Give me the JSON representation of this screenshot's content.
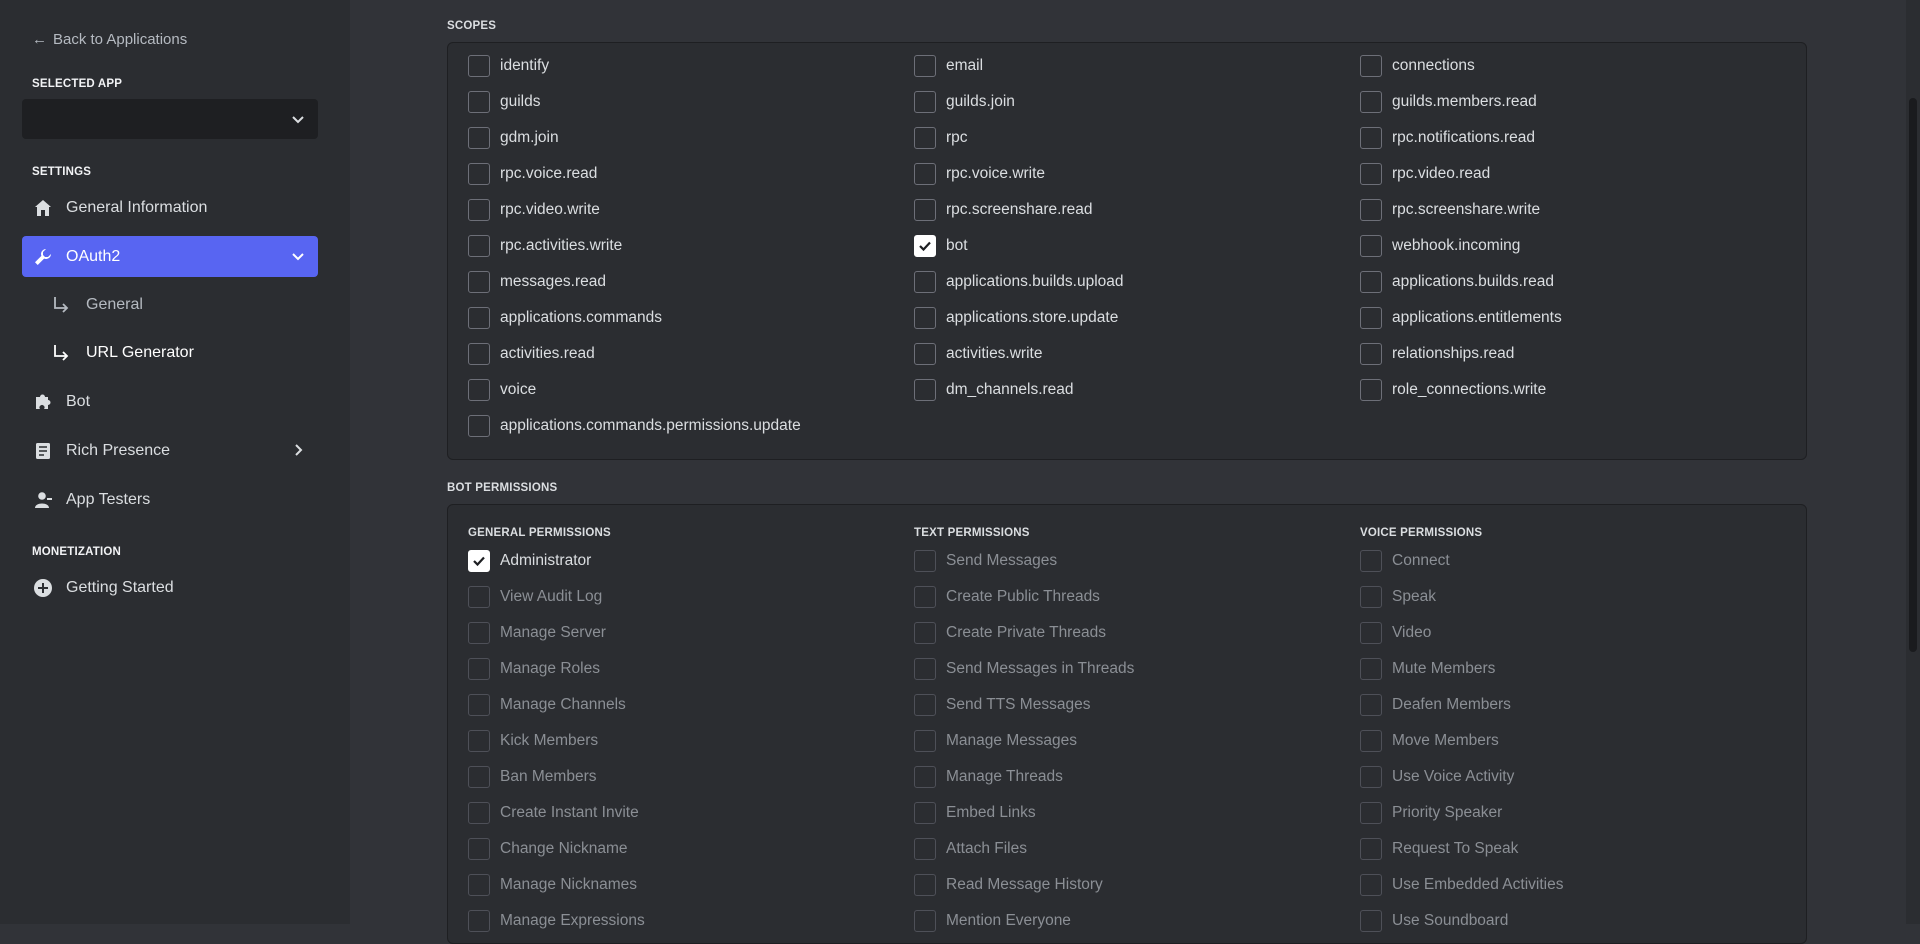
{
  "sidebar": {
    "back_label": "Back to Applications",
    "selected_app_label": "SELECTED APP",
    "selected_app_value": "",
    "settings_label": "SETTINGS",
    "items": [
      {
        "label": "General Information",
        "icon": "home-icon"
      },
      {
        "label": "OAuth2",
        "icon": "wrench-icon"
      },
      {
        "label": "Bot",
        "icon": "puzzle-icon"
      },
      {
        "label": "Rich Presence",
        "icon": "document-icon"
      },
      {
        "label": "App Testers",
        "icon": "user-icon"
      }
    ],
    "oauth_sub": [
      {
        "label": "General"
      },
      {
        "label": "URL Generator"
      }
    ],
    "monetization_label": "MONETIZATION",
    "monetization_items": [
      {
        "label": "Getting Started",
        "icon": "plus-circle-icon"
      }
    ]
  },
  "scopes": {
    "label": "SCOPES",
    "items": [
      {
        "label": "identify",
        "checked": false
      },
      {
        "label": "email",
        "checked": false
      },
      {
        "label": "connections",
        "checked": false
      },
      {
        "label": "guilds",
        "checked": false
      },
      {
        "label": "guilds.join",
        "checked": false
      },
      {
        "label": "guilds.members.read",
        "checked": false
      },
      {
        "label": "gdm.join",
        "checked": false
      },
      {
        "label": "rpc",
        "checked": false
      },
      {
        "label": "rpc.notifications.read",
        "checked": false
      },
      {
        "label": "rpc.voice.read",
        "checked": false
      },
      {
        "label": "rpc.voice.write",
        "checked": false
      },
      {
        "label": "rpc.video.read",
        "checked": false
      },
      {
        "label": "rpc.video.write",
        "checked": false
      },
      {
        "label": "rpc.screenshare.read",
        "checked": false
      },
      {
        "label": "rpc.screenshare.write",
        "checked": false
      },
      {
        "label": "rpc.activities.write",
        "checked": false
      },
      {
        "label": "bot",
        "checked": true
      },
      {
        "label": "webhook.incoming",
        "checked": false
      },
      {
        "label": "messages.read",
        "checked": false
      },
      {
        "label": "applications.builds.upload",
        "checked": false
      },
      {
        "label": "applications.builds.read",
        "checked": false
      },
      {
        "label": "applications.commands",
        "checked": false
      },
      {
        "label": "applications.store.update",
        "checked": false
      },
      {
        "label": "applications.entitlements",
        "checked": false
      },
      {
        "label": "activities.read",
        "checked": false
      },
      {
        "label": "activities.write",
        "checked": false
      },
      {
        "label": "relationships.read",
        "checked": false
      },
      {
        "label": "voice",
        "checked": false
      },
      {
        "label": "dm_channels.read",
        "checked": false
      },
      {
        "label": "role_connections.write",
        "checked": false
      },
      {
        "label": "applications.commands.permissions.update",
        "checked": false
      }
    ]
  },
  "bot_permissions": {
    "label": "BOT PERMISSIONS",
    "columns": [
      {
        "heading": "GENERAL PERMISSIONS",
        "items": [
          {
            "label": "Administrator",
            "checked": true,
            "disabled": false
          },
          {
            "label": "View Audit Log",
            "checked": false,
            "disabled": true
          },
          {
            "label": "Manage Server",
            "checked": false,
            "disabled": true
          },
          {
            "label": "Manage Roles",
            "checked": false,
            "disabled": true
          },
          {
            "label": "Manage Channels",
            "checked": false,
            "disabled": true
          },
          {
            "label": "Kick Members",
            "checked": false,
            "disabled": true
          },
          {
            "label": "Ban Members",
            "checked": false,
            "disabled": true
          },
          {
            "label": "Create Instant Invite",
            "checked": false,
            "disabled": true
          },
          {
            "label": "Change Nickname",
            "checked": false,
            "disabled": true
          },
          {
            "label": "Manage Nicknames",
            "checked": false,
            "disabled": true
          },
          {
            "label": "Manage Expressions",
            "checked": false,
            "disabled": true
          }
        ]
      },
      {
        "heading": "TEXT PERMISSIONS",
        "items": [
          {
            "label": "Send Messages",
            "checked": false,
            "disabled": true
          },
          {
            "label": "Create Public Threads",
            "checked": false,
            "disabled": true
          },
          {
            "label": "Create Private Threads",
            "checked": false,
            "disabled": true
          },
          {
            "label": "Send Messages in Threads",
            "checked": false,
            "disabled": true
          },
          {
            "label": "Send TTS Messages",
            "checked": false,
            "disabled": true
          },
          {
            "label": "Manage Messages",
            "checked": false,
            "disabled": true
          },
          {
            "label": "Manage Threads",
            "checked": false,
            "disabled": true
          },
          {
            "label": "Embed Links",
            "checked": false,
            "disabled": true
          },
          {
            "label": "Attach Files",
            "checked": false,
            "disabled": true
          },
          {
            "label": "Read Message History",
            "checked": false,
            "disabled": true
          },
          {
            "label": "Mention Everyone",
            "checked": false,
            "disabled": true
          }
        ]
      },
      {
        "heading": "VOICE PERMISSIONS",
        "items": [
          {
            "label": "Connect",
            "checked": false,
            "disabled": true
          },
          {
            "label": "Speak",
            "checked": false,
            "disabled": true
          },
          {
            "label": "Video",
            "checked": false,
            "disabled": true
          },
          {
            "label": "Mute Members",
            "checked": false,
            "disabled": true
          },
          {
            "label": "Deafen Members",
            "checked": false,
            "disabled": true
          },
          {
            "label": "Move Members",
            "checked": false,
            "disabled": true
          },
          {
            "label": "Use Voice Activity",
            "checked": false,
            "disabled": true
          },
          {
            "label": "Priority Speaker",
            "checked": false,
            "disabled": true
          },
          {
            "label": "Request To Speak",
            "checked": false,
            "disabled": true
          },
          {
            "label": "Use Embedded Activities",
            "checked": false,
            "disabled": true
          },
          {
            "label": "Use Soundboard",
            "checked": false,
            "disabled": true
          }
        ]
      }
    ]
  },
  "colors": {
    "accent": "#5865f2",
    "sidebar_bg": "#2b2d31",
    "main_bg": "#313338"
  }
}
